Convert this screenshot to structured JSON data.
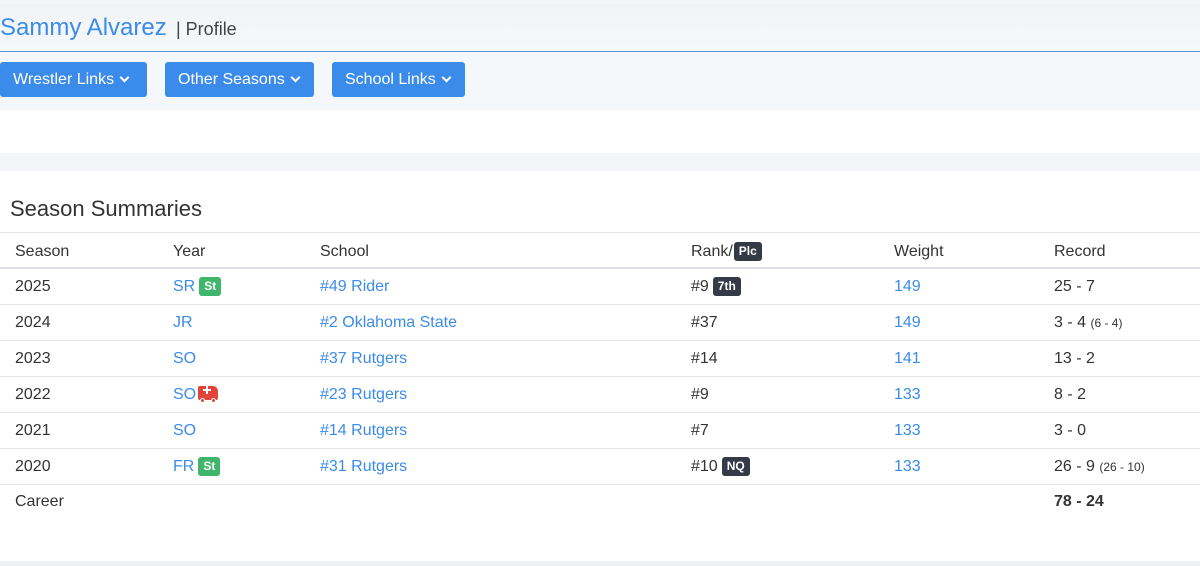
{
  "header": {
    "wrestler_name": "Sammy Alvarez",
    "separator_label": "| Profile"
  },
  "buttons": {
    "wrestler_links": "Wrestler Links",
    "other_seasons": "Other Seasons",
    "school_links": "School Links"
  },
  "section": {
    "title": "Season Summaries"
  },
  "table": {
    "headers": {
      "season": "Season",
      "year": "Year",
      "school": "School",
      "rank": "Rank/",
      "rank_badge": "Plc",
      "weight": "Weight",
      "record": "Record"
    },
    "rows": [
      {
        "season": "2025",
        "year": "SR",
        "year_badge": "St",
        "school": "#49 Rider",
        "rank": "#9",
        "rank_badge": "7th",
        "weight": "149",
        "record": "25 - 7",
        "record_extra": ""
      },
      {
        "season": "2024",
        "year": "JR",
        "year_badge": "",
        "school": "#2 Oklahoma State",
        "rank": "#37",
        "rank_badge": "",
        "weight": "149",
        "record": "3 - 4",
        "record_extra": "(6 - 4)"
      },
      {
        "season": "2023",
        "year": "SO",
        "year_badge": "",
        "school": "#37 Rutgers",
        "rank": "#14",
        "rank_badge": "",
        "weight": "141",
        "record": "13 - 2",
        "record_extra": ""
      },
      {
        "season": "2022",
        "year": "SO",
        "year_badge": "",
        "school": "#23 Rutgers",
        "rank": "#9",
        "rank_badge": "",
        "weight": "133",
        "record": "8 - 2",
        "record_extra": ""
      },
      {
        "season": "2021",
        "year": "SO",
        "year_badge": "",
        "school": "#14 Rutgers",
        "rank": "#7",
        "rank_badge": "",
        "weight": "133",
        "record": "3 - 0",
        "record_extra": ""
      },
      {
        "season": "2020",
        "year": "FR",
        "year_badge": "St",
        "school": "#31 Rutgers",
        "rank": "#10",
        "rank_badge": "NQ",
        "weight": "133",
        "record": "26 - 9",
        "record_extra": "(26 - 10)"
      }
    ],
    "career": {
      "label": "Career",
      "record": "78 - 24"
    }
  },
  "icons": {
    "dropdown": "chevron-down-icon",
    "injury": "ambulance-icon"
  },
  "colors": {
    "link": "#3b8bea",
    "button": "#3b8bea",
    "badge_green": "#3fb66b",
    "badge_dark": "#343a46",
    "injury": "#e0443a"
  }
}
